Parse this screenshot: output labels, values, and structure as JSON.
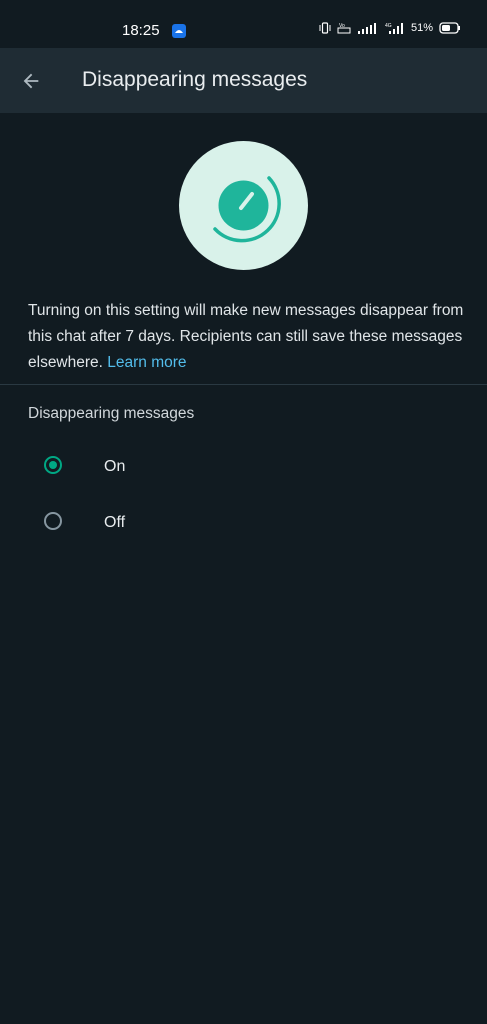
{
  "status_bar": {
    "time": "18:25",
    "volte": "Vo LTE",
    "network": "4G",
    "battery": "51%"
  },
  "header": {
    "title": "Disappearing messages",
    "back_icon": "arrow-left-icon"
  },
  "hero": {
    "icon": "timer-icon",
    "background_color": "#d9f2ea",
    "accent_color": "#1fb59b"
  },
  "description": {
    "text": "Turning on this setting will make new messages disappear from this chat after 7 days. Recipients can still save these messages elsewhere. ",
    "link_text": "Learn more"
  },
  "settings": {
    "section_label": "Disappearing messages",
    "options": [
      {
        "label": "On",
        "selected": true
      },
      {
        "label": "Off",
        "selected": false
      }
    ]
  },
  "colors": {
    "background": "#111b21",
    "app_bar": "#1f2c34",
    "accent": "#00a884",
    "link": "#53bdeb"
  }
}
